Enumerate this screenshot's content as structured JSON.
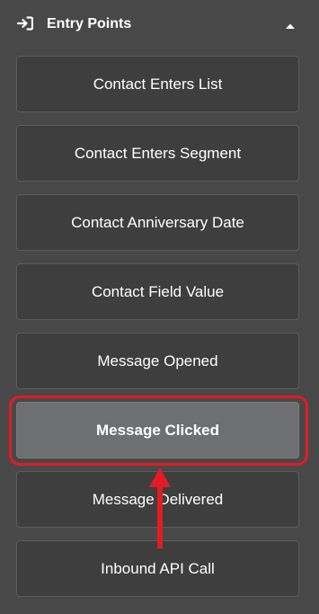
{
  "section": {
    "title": "Entry Points",
    "icon": "sign-in-icon",
    "collapse_icon": "caret-up-icon"
  },
  "entry_points": [
    {
      "label": "Contact Enters List",
      "selected": false
    },
    {
      "label": "Contact Enters Segment",
      "selected": false
    },
    {
      "label": "Contact Anniversary Date",
      "selected": false
    },
    {
      "label": "Contact Field Value",
      "selected": false
    },
    {
      "label": "Message Opened",
      "selected": false
    },
    {
      "label": "Message Clicked",
      "selected": true
    },
    {
      "label": "Message Delivered",
      "selected": false
    },
    {
      "label": "Inbound API Call",
      "selected": false
    }
  ],
  "annotation": {
    "highlight_color": "#e31b23",
    "target_item": "Message Clicked",
    "pointer_icon": "arrow-up-icon"
  },
  "colors": {
    "background": "#484848",
    "item_background": "#3e3e3e",
    "item_border": "#5c5c5c",
    "selected_background": "#6e6f73",
    "text": "#ffffff"
  }
}
